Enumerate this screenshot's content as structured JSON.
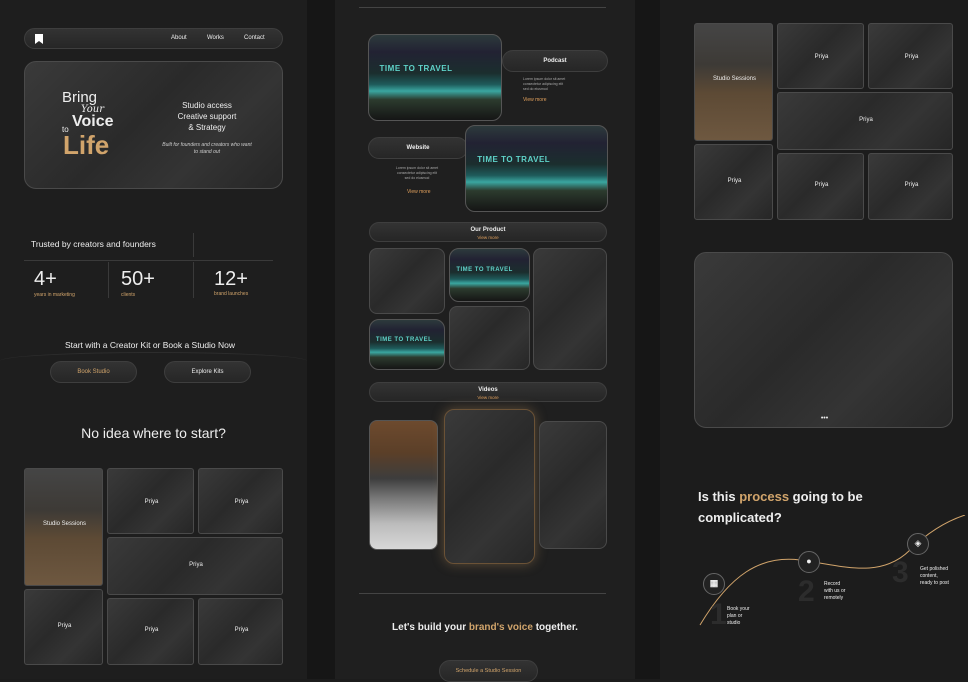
{
  "landing": {
    "nav": {
      "about": "About",
      "works": "Works",
      "contact": "Contact"
    },
    "hero": {
      "bring": "Bring",
      "your": "Your",
      "voice": "Voice",
      "to": "to",
      "life": "Life",
      "bullets": [
        "Studio access",
        "Creative support",
        "& Strategy"
      ],
      "tagline_1": "Built for founders and creators who want",
      "tagline_2": "to stand out"
    },
    "trusted": "Trusted by creators and founders",
    "stats": [
      {
        "value": "4+",
        "label": "years in marketing"
      },
      {
        "value": "50+",
        "label": "clients"
      },
      {
        "value": "12+",
        "label": "brand launches"
      }
    ],
    "cta_heading": "Start with a Creator Kit or Book a Studio Now",
    "book_studio": "Book Studio",
    "explore_kits": "Explore Kits",
    "no_idea": "No idea where to start?",
    "grid": {
      "studio_sessions": "Studio Sessions",
      "priya": "Priya"
    }
  },
  "works": {
    "travel_title": "TIME TO TRAVEL",
    "podcast": "Podcast",
    "podcast_desc": [
      "Lorem ipsum dolor sit amet",
      "consectetur adipiscing elit",
      "sed do eiusmod"
    ],
    "view_more": "View more",
    "website": "Website",
    "website_desc": [
      "Lorem ipsum dolor sit amet",
      "consectetur adipiscing elit",
      "sed do eiusmod"
    ],
    "our_product": "Our Product",
    "videos": "Videos",
    "build_prefix": "Let's build your ",
    "build_highlight": "brand's voice",
    "build_suffix": " together.",
    "schedule": "Schedule a Studio Session"
  },
  "process": {
    "studio_sessions": "Studio Sessions",
    "priya": "Priya",
    "dots": "•••",
    "heading_1": "Is this ",
    "heading_highlight": "process",
    "heading_2": " going to be",
    "heading_3": "complicated?",
    "steps": [
      {
        "num": "1",
        "text": [
          "Book your",
          "plan or",
          "studio"
        ]
      },
      {
        "num": "2",
        "text": [
          "Record",
          "with us or",
          "remotely"
        ]
      },
      {
        "num": "3",
        "text": [
          "Get polished",
          "content,",
          "ready to post"
        ]
      }
    ]
  },
  "colors": {
    "accent": "#d1a46b",
    "background": "#1e1e1e",
    "teal": "#5fd3c9"
  }
}
